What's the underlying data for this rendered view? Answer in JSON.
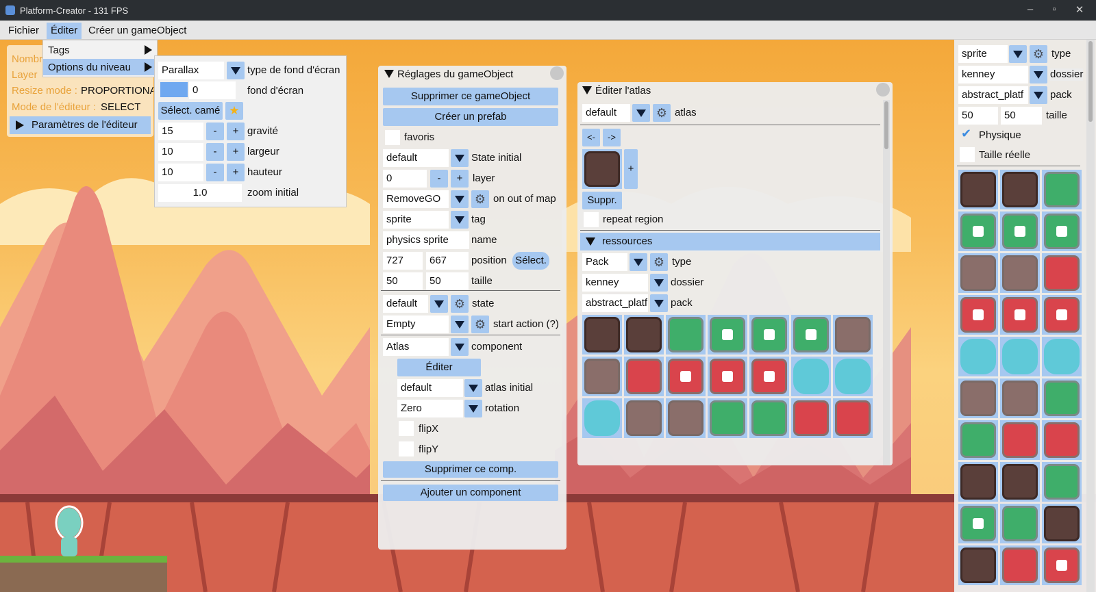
{
  "window": {
    "title": "Platform-Creator - 131 FPS",
    "min_glyph": "–",
    "max_glyph": "▫",
    "close_glyph": "✕"
  },
  "menubar": {
    "fichier": "Fichier",
    "editer": "Éditer",
    "creer": "Créer un gameObject"
  },
  "edit_menu": {
    "tags": "Tags",
    "options": "Options du niveau"
  },
  "level_options": {
    "bg_type_value": "Parallax",
    "bg_type_label": "type de fond d'écran",
    "bg_value": "0",
    "bg_label": "fond d'écran",
    "select_camera": "Sélect. camé",
    "star_glyph": "★",
    "gravity_value": "15",
    "gravity_label": "gravité",
    "width_value": "10",
    "width_label": "largeur",
    "height_value": "10",
    "height_label": "hauteur",
    "zoom_value": "1.0",
    "zoom_label": "zoom initial",
    "minus": "-",
    "plus": "+"
  },
  "info_panel": {
    "nombre": "Nombre",
    "layer": "Layer",
    "resize_label": "Resize mode :",
    "resize_value": "PROPORTIONAL",
    "mode_label": "Mode de l'éditeur :",
    "mode_value": "SELECT",
    "params": "Paramètres de l'éditeur"
  },
  "go_settings": {
    "title": "Réglages du gameObject",
    "delete_go": "Supprimer ce gameObject",
    "create_prefab": "Créer un prefab",
    "favoris": "favoris",
    "state_initial_value": "default",
    "state_initial_label": "State initial",
    "layer_value": "0",
    "layer_label": "layer",
    "minus": "-",
    "plus": "+",
    "out_of_map_value": "RemoveGO",
    "out_of_map_label": "on out of map",
    "tag_value": "sprite",
    "tag_label": "tag",
    "name_value": "physics sprite",
    "name_label": "name",
    "pos_x": "727",
    "pos_y": "667",
    "position_label": "position",
    "select_btn": "Sélect.",
    "size_w": "50",
    "size_h": "50",
    "size_label": "taille",
    "state_value": "default",
    "state_label": "state",
    "start_action_value": "Empty",
    "start_action_label": "start action (?)",
    "component_value": "Atlas",
    "component_label": "component",
    "edit_btn": "Éditer",
    "atlas_initial_value": "default",
    "atlas_initial_label": "atlas initial",
    "rotation_value": "Zero",
    "rotation_label": "rotation",
    "flipx": "flipX",
    "flipy": "flipY",
    "delete_comp": "Supprimer ce comp.",
    "add_comp": "Ajouter un component"
  },
  "atlas_editor": {
    "title": "Éditer l'atlas",
    "atlas_value": "default",
    "atlas_label": "atlas",
    "prev": "<-",
    "next": "->",
    "add": "+",
    "suppr": "Suppr.",
    "repeat": "repeat region",
    "resources": "ressources",
    "type_value": "Pack",
    "type_label": "type",
    "folder_value": "kenney",
    "folder_label": "dossier",
    "pack_value": "abstract_platf",
    "pack_label": "pack"
  },
  "right_panel": {
    "type_value": "sprite",
    "type_label": "type",
    "folder_value": "kenney",
    "folder_label": "dossier",
    "pack_value": "abstract_platf",
    "pack_label": "pack",
    "w": "50",
    "h": "50",
    "size_label": "taille",
    "physics": "Physique",
    "physics_checked": true,
    "check_glyph": "✔",
    "real_size": "Taille réelle"
  },
  "gear_glyph": "⚙",
  "colors": {
    "accent": "#a6c8f0",
    "dark_tile": "#5a3f3a",
    "green_tile": "#3fae6a",
    "red_tile": "#d9444c",
    "cyan_tile": "#5fc9d8",
    "brown_tile": "#8a6e6a"
  }
}
